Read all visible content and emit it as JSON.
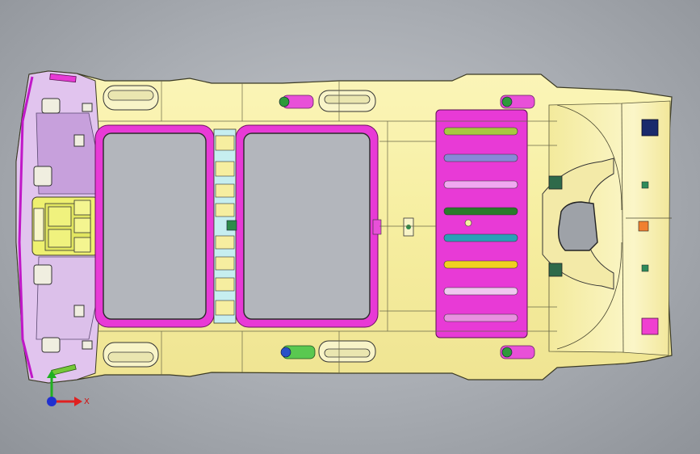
{
  "viewport": {
    "background": "#aeb2b8",
    "view": "top"
  },
  "model": {
    "part": "headliner",
    "colors": {
      "surface": "#f6eea0",
      "edge": "#3a3a2a",
      "magenta": "#e83ad6",
      "lavender": "#d8b4e6",
      "yellow_green": "#e8f070",
      "cyan": "#9fe8ee",
      "green": "#2ea04a",
      "navy": "#1a2a6c",
      "orange": "#f08030"
    },
    "sunroof_openings": 2,
    "label_stripes": [
      {
        "color": "#a8c840"
      },
      {
        "color": "#8888d8"
      },
      {
        "color": "#f0a8f0"
      },
      {
        "color": "#2a7a2a"
      },
      {
        "color": "#2aa0b8"
      },
      {
        "color": "#f0d020"
      },
      {
        "color": "#f0c8f0"
      },
      {
        "color": "#e890e0"
      }
    ]
  },
  "triad": {
    "x_label": "X",
    "x_color": "#e02020",
    "y_color": "#20b020",
    "z_color": "#2030d0"
  }
}
